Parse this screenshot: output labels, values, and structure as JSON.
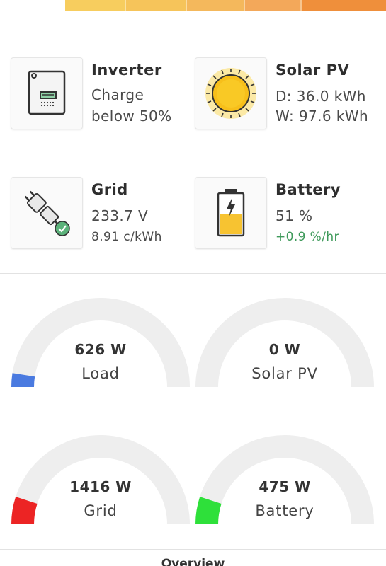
{
  "colors": {
    "topbar": [
      "#f7cd5e",
      "#f6c45a",
      "#f4b85c",
      "#f3a85a",
      "#ef8f3b"
    ],
    "gauge_track": "#eeeeee",
    "load": "#4a7ae0",
    "solar": "#eeeeee",
    "grid": "#ec2424",
    "battery": "#2ee03a",
    "positive_rate": "#3f9a5b"
  },
  "cards": {
    "inverter": {
      "title": "Inverter",
      "line1": "Charge",
      "line2": "below 50%",
      "icon": "inverter-icon"
    },
    "solar": {
      "title": "Solar PV",
      "line1": "D: 36.0 kWh",
      "line2": "W: 97.6 kWh",
      "icon": "sun-icon"
    },
    "grid": {
      "title": "Grid",
      "line1": "233.7 V",
      "line2": "8.91 c/kWh",
      "icon": "plug-icon"
    },
    "battery": {
      "title": "Battery",
      "line1": "51 %",
      "line2": "+0.9 %/hr",
      "icon": "battery-icon",
      "level": 0.51
    }
  },
  "gauges": [
    {
      "key": "load",
      "value": "626 W",
      "label": "Load",
      "fraction": 0.05
    },
    {
      "key": "solar",
      "value": "0 W",
      "label": "Solar PV",
      "fraction": 0.0
    },
    {
      "key": "grid",
      "value": "1416 W",
      "label": "Grid",
      "fraction": 0.1
    },
    {
      "key": "battery",
      "value": "475 W",
      "label": "Battery",
      "fraction": 0.1
    }
  ],
  "tabs": {
    "overview": "Overview"
  }
}
